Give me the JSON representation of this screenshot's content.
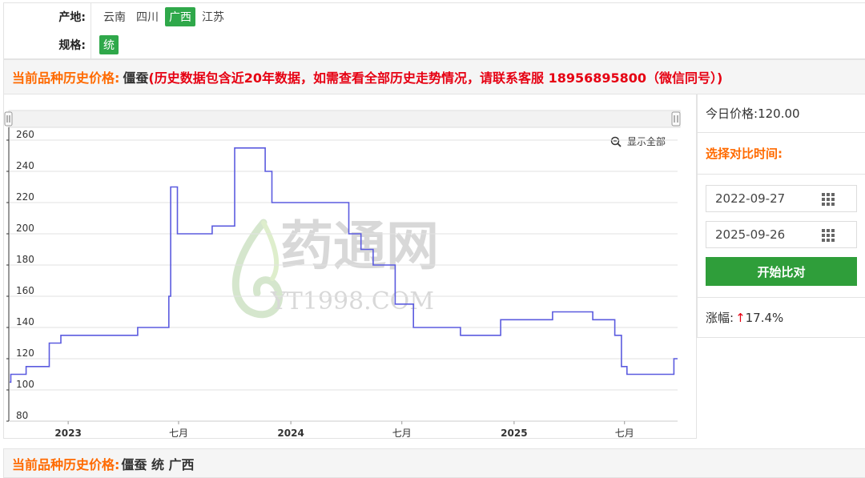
{
  "filters": {
    "origin": {
      "label": "产地:",
      "options": [
        "云南",
        "四川",
        "广西",
        "江苏"
      ],
      "selected": "广西"
    },
    "spec": {
      "label": "规格:",
      "options": [
        "统"
      ],
      "selected": "统"
    }
  },
  "notice": {
    "key": "当前品种历史价格:",
    "name": "僵蚕",
    "message": "(历史数据包含近20年数据，如需查看全部历史走势情况，请联系客服 18956895800（微信同号）)"
  },
  "chart": {
    "zoom_label": "显示全部",
    "watermark": {
      "text": "药通网",
      "sub": "YT1998.COM"
    }
  },
  "chart_data": {
    "type": "line",
    "step": true,
    "title": "",
    "xlabel": "",
    "ylabel": "",
    "ylim": [
      80,
      260
    ],
    "yticks": [
      80,
      100,
      120,
      140,
      160,
      180,
      200,
      220,
      240,
      260
    ],
    "xticks": [
      {
        "label": "2023",
        "date": "2023-01-01",
        "bold": true
      },
      {
        "label": "七月",
        "date": "2023-07-01",
        "bold": false
      },
      {
        "label": "2024",
        "date": "2024-01-01",
        "bold": true
      },
      {
        "label": "七月",
        "date": "2024-07-01",
        "bold": false
      },
      {
        "label": "2025",
        "date": "2025-01-01",
        "bold": true
      },
      {
        "label": "七月",
        "date": "2025-07-01",
        "bold": false
      }
    ],
    "grid": true,
    "series": [
      {
        "color": "#5b5bdf",
        "points": [
          [
            "2022-09-27",
            105
          ],
          [
            "2022-09-29",
            110
          ],
          [
            "2022-10-24",
            115
          ],
          [
            "2022-12-01",
            130
          ],
          [
            "2022-12-20",
            135
          ],
          [
            "2023-04-25",
            140
          ],
          [
            "2023-06-15",
            160
          ],
          [
            "2023-06-18",
            230
          ],
          [
            "2023-06-29",
            200
          ],
          [
            "2023-08-25",
            205
          ],
          [
            "2023-10-01",
            255
          ],
          [
            "2023-11-20",
            240
          ],
          [
            "2023-12-01",
            220
          ],
          [
            "2024-04-05",
            200
          ],
          [
            "2024-04-25",
            190
          ],
          [
            "2024-05-15",
            180
          ],
          [
            "2024-06-20",
            155
          ],
          [
            "2024-07-20",
            140
          ],
          [
            "2024-10-05",
            135
          ],
          [
            "2024-12-10",
            145
          ],
          [
            "2025-03-05",
            150
          ],
          [
            "2025-05-10",
            145
          ],
          [
            "2025-06-15",
            135
          ],
          [
            "2025-06-26",
            115
          ],
          [
            "2025-07-05",
            110
          ],
          [
            "2025-09-20",
            120
          ],
          [
            "2025-09-26",
            120
          ]
        ]
      }
    ]
  },
  "side": {
    "today_label": "今日价格:",
    "today_value": "120.00",
    "compare_title": "选择对比时间:",
    "date_start": "2022-09-27",
    "date_end": "2025-09-26",
    "start_button": "开始比对",
    "rise_label": "涨幅:",
    "rise_arrow": "↑",
    "rise_value": "17.4%",
    "accent": "#ff6a00",
    "button_color": "#2f9e3a"
  },
  "bottom": {
    "key": "当前品种历史价格:",
    "value": "僵蚕 统 广西"
  }
}
